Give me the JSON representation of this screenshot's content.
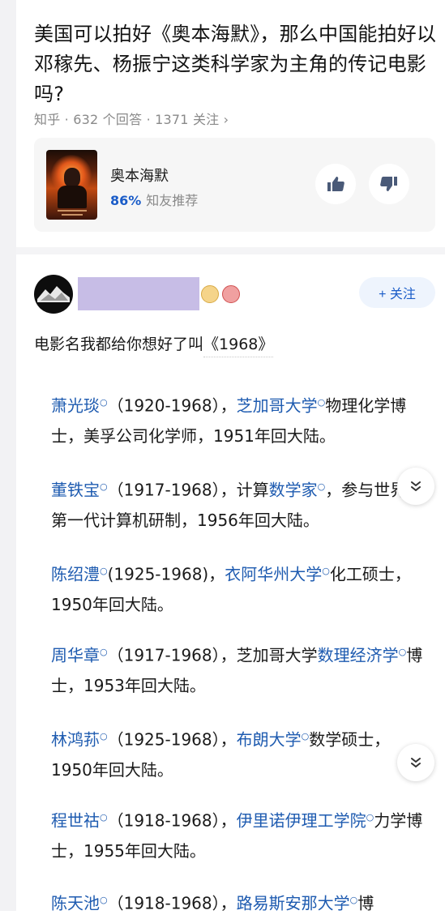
{
  "question": {
    "title": "美国可以拍好《奥本海默》，那么中国能拍好以邓稼先、杨振宁这类科学家为主角的传记电影吗?",
    "meta": "知乎 · 632 个回答 · 1371 关注 ›"
  },
  "movie_card": {
    "name": "奥本海默",
    "score": "86%",
    "score_label": "知友推荐",
    "upvote_icon": "thumbs-up-icon",
    "downvote_icon": "thumbs-down-icon"
  },
  "author": {
    "follow_label": "+ 关注"
  },
  "answer": {
    "intro_prefix": "电影名我都给你想好了叫",
    "intro_link": "《1968》",
    "entries": [
      {
        "a": "萧光琰",
        "b": "（1920-1968），",
        "c": "芝加哥大学",
        "d": "物理化学博士，美孚公司化学师，1951年回大陆。"
      },
      {
        "a": "董铁宝",
        "b": "（1917-1968），计算",
        "c": "数学家",
        "d": "，参与世界上第一代计算机研制，1956年回大陆。"
      },
      {
        "a": "陈绍澧",
        "b": "(1925-1968)，",
        "c": "衣阿华州大学",
        "d": "化工硕士，1950年回大陆。"
      },
      {
        "a": "周华章",
        "b": "（1917-1968），芝加哥大学",
        "c": "数理经济学",
        "d": "博士，1953年回大陆。"
      },
      {
        "a": "林鸿荪",
        "b": "（1925-1968），",
        "c": "布朗大学",
        "d": "数学硕士，1950年回大陆。"
      },
      {
        "a": "程世祜",
        "b": "（1918-1968），",
        "c": "伊里诺伊理工学院",
        "d": "力学博士，1955年回大陆。"
      },
      {
        "a": "陈天池",
        "b": "（1918-1968），",
        "c": "路易斯安那大学",
        "d": "博"
      }
    ]
  },
  "ui": {
    "collapse_icon": "double-chevron-down-icon"
  }
}
